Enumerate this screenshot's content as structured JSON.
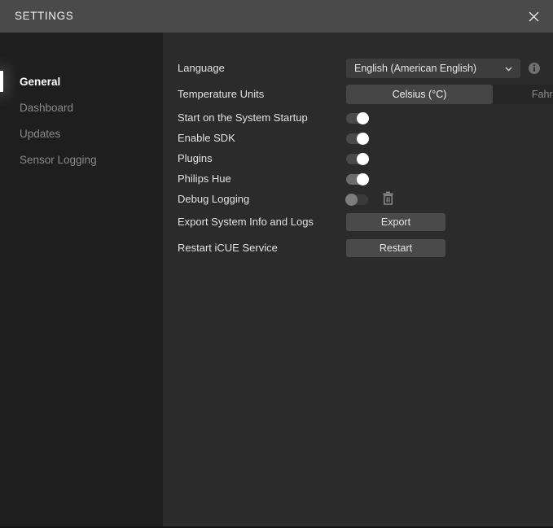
{
  "window": {
    "title": "SETTINGS",
    "close_icon": "close-icon"
  },
  "sidebar": {
    "items": [
      {
        "label": "General",
        "active": true
      },
      {
        "label": "Dashboard",
        "active": false
      },
      {
        "label": "Updates",
        "active": false
      },
      {
        "label": "Sensor Logging",
        "active": false
      }
    ]
  },
  "settings": {
    "language": {
      "label": "Language",
      "value": "English (American English)",
      "chevron_icon": "chevron-down-icon",
      "info_icon": "info-icon"
    },
    "temperature_units": {
      "label": "Temperature Units",
      "options": [
        "Celsius (°C)",
        "Fahrenheit (°F)"
      ],
      "selected": "Celsius (°C)"
    },
    "start_on_startup": {
      "label": "Start on the System Startup",
      "state": "on"
    },
    "enable_sdk": {
      "label": "Enable SDK",
      "state": "on"
    },
    "plugins": {
      "label": "Plugins",
      "state": "on"
    },
    "philips_hue": {
      "label": "Philips Hue",
      "state": "on"
    },
    "debug_logging": {
      "label": "Debug Logging",
      "state": "off",
      "delete_icon": "trash-icon"
    },
    "export_logs": {
      "label": "Export System Info and Logs",
      "button": "Export"
    },
    "restart_service": {
      "label": "Restart iCUE Service",
      "button": "Restart"
    }
  },
  "colors": {
    "titlebar": "#4a4a4a",
    "sidebar": "#1e1e1e",
    "content": "#2b2b2b",
    "accent": "#ffffff",
    "control": "#3d3d3d",
    "button": "#4a4a4a"
  }
}
